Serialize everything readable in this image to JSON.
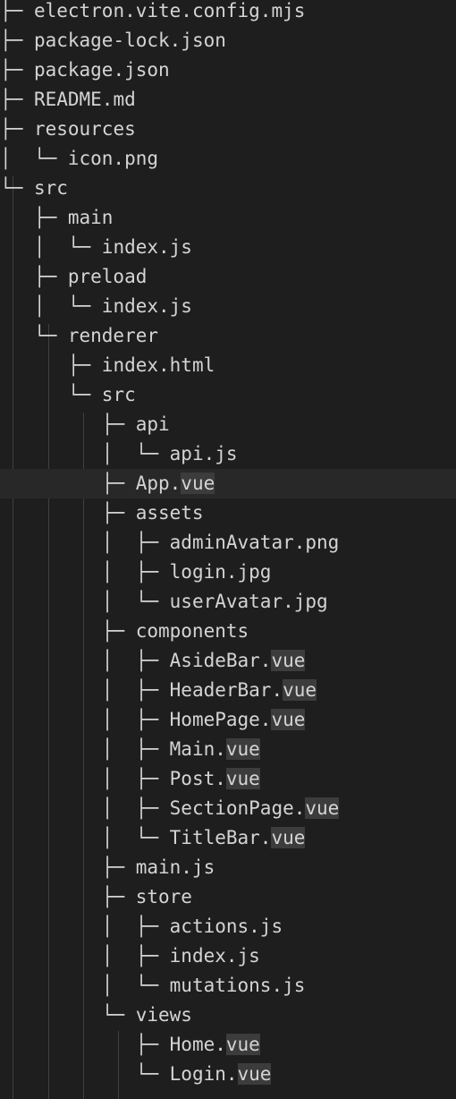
{
  "lines": [
    {
      "prefix": "├─ ",
      "name": "electron.vite.config.mjs",
      "ext": ""
    },
    {
      "prefix": "├─ ",
      "name": "package-lock.json",
      "ext": ""
    },
    {
      "prefix": "├─ ",
      "name": "package.json",
      "ext": ""
    },
    {
      "prefix": "├─ ",
      "name": "README.md",
      "ext": ""
    },
    {
      "prefix": "├─ ",
      "name": "resources",
      "ext": ""
    },
    {
      "prefix": "│  └─ ",
      "name": "icon.png",
      "ext": ""
    },
    {
      "prefix": "└─ ",
      "name": "src",
      "ext": ""
    },
    {
      "prefix": "   ├─ ",
      "name": "main",
      "ext": ""
    },
    {
      "prefix": "   │  └─ ",
      "name": "index.js",
      "ext": ""
    },
    {
      "prefix": "   ├─ ",
      "name": "preload",
      "ext": ""
    },
    {
      "prefix": "   │  └─ ",
      "name": "index.js",
      "ext": ""
    },
    {
      "prefix": "   └─ ",
      "name": "renderer",
      "ext": ""
    },
    {
      "prefix": "      ├─ ",
      "name": "index.html",
      "ext": ""
    },
    {
      "prefix": "      └─ ",
      "name": "src",
      "ext": ""
    },
    {
      "prefix": "         ├─ ",
      "name": "api",
      "ext": ""
    },
    {
      "prefix": "         │  └─ ",
      "name": "api.js",
      "ext": ""
    },
    {
      "prefix": "         ├─ ",
      "name": "App.",
      "ext": "vue",
      "current": true
    },
    {
      "prefix": "         ├─ ",
      "name": "assets",
      "ext": ""
    },
    {
      "prefix": "         │  ├─ ",
      "name": "adminAvatar.png",
      "ext": ""
    },
    {
      "prefix": "         │  ├─ ",
      "name": "login.jpg",
      "ext": ""
    },
    {
      "prefix": "         │  └─ ",
      "name": "userAvatar.jpg",
      "ext": ""
    },
    {
      "prefix": "         ├─ ",
      "name": "components",
      "ext": ""
    },
    {
      "prefix": "         │  ├─ ",
      "name": "AsideBar.",
      "ext": "vue"
    },
    {
      "prefix": "         │  ├─ ",
      "name": "HeaderBar.",
      "ext": "vue"
    },
    {
      "prefix": "         │  ├─ ",
      "name": "HomePage.",
      "ext": "vue"
    },
    {
      "prefix": "         │  ├─ ",
      "name": "Main.",
      "ext": "vue"
    },
    {
      "prefix": "         │  ├─ ",
      "name": "Post.",
      "ext": "vue"
    },
    {
      "prefix": "         │  ├─ ",
      "name": "SectionPage.",
      "ext": "vue"
    },
    {
      "prefix": "         │  └─ ",
      "name": "TitleBar.",
      "ext": "vue"
    },
    {
      "prefix": "         ├─ ",
      "name": "main.js",
      "ext": ""
    },
    {
      "prefix": "         ├─ ",
      "name": "store",
      "ext": ""
    },
    {
      "prefix": "         │  ├─ ",
      "name": "actions.js",
      "ext": ""
    },
    {
      "prefix": "         │  ├─ ",
      "name": "index.js",
      "ext": ""
    },
    {
      "prefix": "         │  └─ ",
      "name": "mutations.js",
      "ext": ""
    },
    {
      "prefix": "         └─ ",
      "name": "views",
      "ext": ""
    },
    {
      "prefix": "            ├─ ",
      "name": "Home.",
      "ext": "vue"
    },
    {
      "prefix": "            └─ ",
      "name": "Login.",
      "ext": "vue"
    }
  ]
}
